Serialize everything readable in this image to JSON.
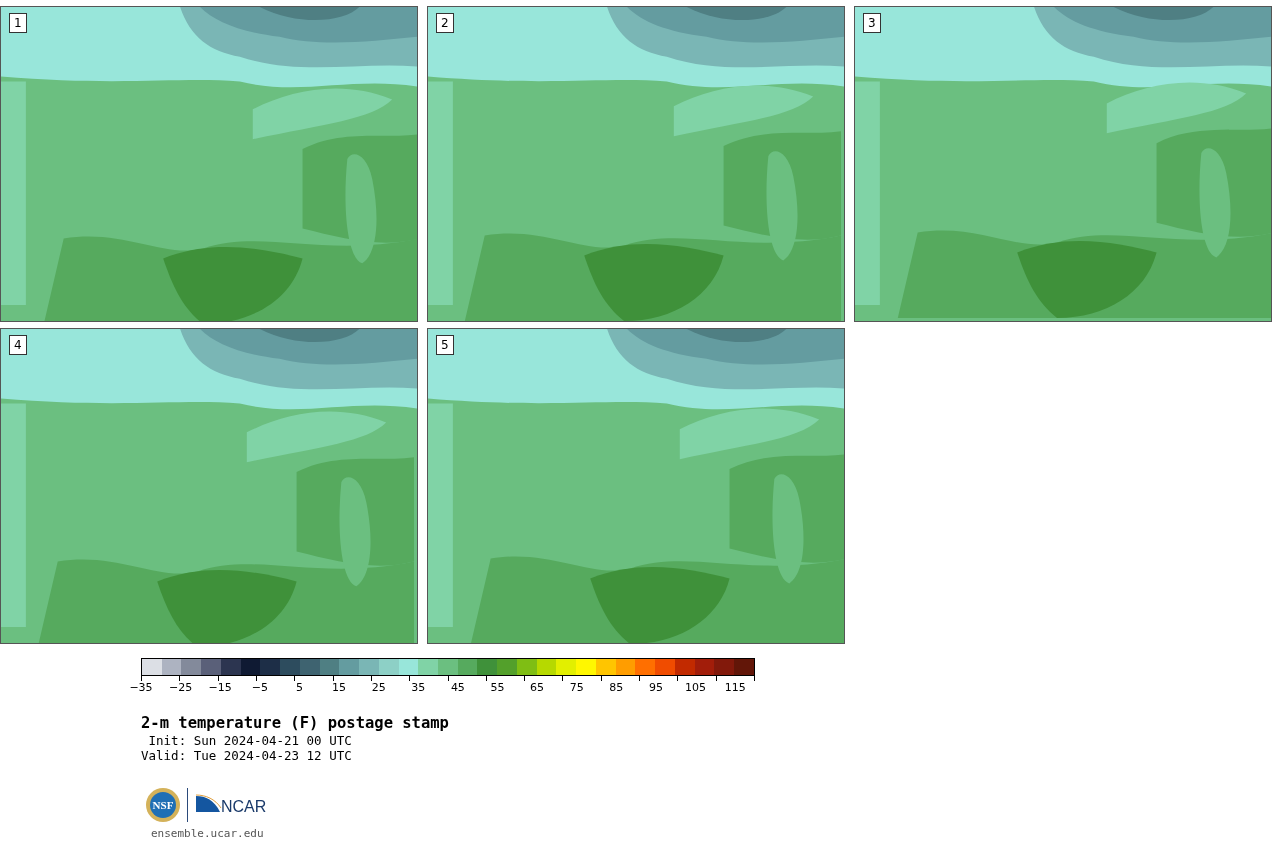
{
  "panels": [
    {
      "label": "1"
    },
    {
      "label": "2"
    },
    {
      "label": "3"
    },
    {
      "label": "4"
    },
    {
      "label": "5"
    }
  ],
  "colorbar": {
    "bins": [
      {
        "color": "#dcdfe5"
      },
      {
        "color": "#adb3c1"
      },
      {
        "color": "#838a9b"
      },
      {
        "color": "#5a6079"
      },
      {
        "color": "#2c3550"
      },
      {
        "color": "#0f1a33"
      },
      {
        "color": "#1d2e47"
      },
      {
        "color": "#2d4c5e"
      },
      {
        "color": "#3e6370"
      },
      {
        "color": "#4f7f83"
      },
      {
        "color": "#649ca0"
      },
      {
        "color": "#7ab6b5"
      },
      {
        "color": "#8dd0c6"
      },
      {
        "color": "#98e6da"
      },
      {
        "color": "#80d3a6"
      },
      {
        "color": "#6bbf80"
      },
      {
        "color": "#56aa5e"
      },
      {
        "color": "#3f913a"
      },
      {
        "color": "#53a02b"
      },
      {
        "color": "#7fbe14"
      },
      {
        "color": "#b6d900"
      },
      {
        "color": "#e2ef00"
      },
      {
        "color": "#fff700"
      },
      {
        "color": "#ffc500"
      },
      {
        "color": "#ff9d00"
      },
      {
        "color": "#ff6f00"
      },
      {
        "color": "#f04c00"
      },
      {
        "color": "#c22a00"
      },
      {
        "color": "#a21d0a"
      },
      {
        "color": "#82190b"
      },
      {
        "color": "#621608"
      }
    ],
    "tick_labels": [
      "−35",
      "−25",
      "−15",
      "−5",
      "5",
      "15",
      "25",
      "35",
      "45",
      "55",
      "65",
      "75",
      "85",
      "95",
      "105",
      "115"
    ]
  },
  "title": "2-m temperature (F) postage stamp",
  "init": " Init: Sun 2024-04-21 00 UTC",
  "valid": "Valid: Tue 2024-04-23 12 UTC",
  "logos": {
    "nsf": "NSF",
    "ncar": "NCAR"
  },
  "footer": "ensemble.ucar.edu"
}
